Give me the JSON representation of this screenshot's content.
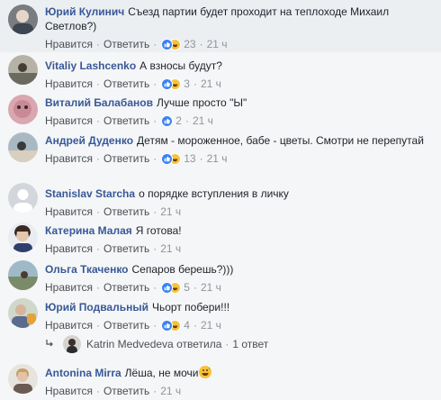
{
  "actions": {
    "like": "Нравится",
    "reply": "Ответить",
    "sep": "·"
  },
  "colors": {
    "author_link": "#385898",
    "like_blue": "#3b82f6",
    "haha_yellow": "#f5c33b"
  },
  "comments": [
    {
      "author": "Юрий Кулинич",
      "text": "Съезд партии будет проходит на теплоходе Михаил Светлов?)",
      "reactions": [
        "like",
        "haha"
      ],
      "count": "23",
      "time": "21 ч"
    },
    {
      "author": "Vitaliy Lashcenko",
      "text": "А взносы будут?",
      "reactions": [
        "like",
        "haha"
      ],
      "count": "3",
      "time": "21 ч"
    },
    {
      "author": "Виталий Балабанов",
      "text": "Лучше просто \"Ы\"",
      "reactions": [
        "like"
      ],
      "count": "2",
      "time": "21 ч"
    },
    {
      "author": "Андрей Дуденко",
      "text": "Детям - мороженное, бабе - цветы. Смотри не перепутай",
      "reactions": [
        "like",
        "haha"
      ],
      "count": "13",
      "time": "21 ч"
    },
    {
      "author": "Stanislav Starcha",
      "text": "о порядке вступления в личку",
      "reactions": [],
      "count": "",
      "time": "21 ч"
    },
    {
      "author": "Катерина Малая",
      "text": "Я готова!",
      "reactions": [],
      "count": "",
      "time": "21 ч"
    },
    {
      "author": "Ольга Ткаченко",
      "text": "Сепаров берешь?)))",
      "reactions": [
        "like",
        "haha"
      ],
      "count": "5",
      "time": "21 ч"
    },
    {
      "author": "Юрий Подвальный",
      "text": "Чьорт побери!!!",
      "reactions": [
        "like",
        "haha"
      ],
      "count": "4",
      "time": "21 ч"
    },
    {
      "author": "Antonina Mirra",
      "text": "Лёша, не мочи",
      "reactions": [],
      "count": "",
      "time": "21 ч",
      "emoji": "grinning-sweat-emoji"
    }
  ],
  "reply_summary": {
    "author": "Katrin Medvedeva",
    "verb": "ответила",
    "count_label": "1 ответ"
  }
}
